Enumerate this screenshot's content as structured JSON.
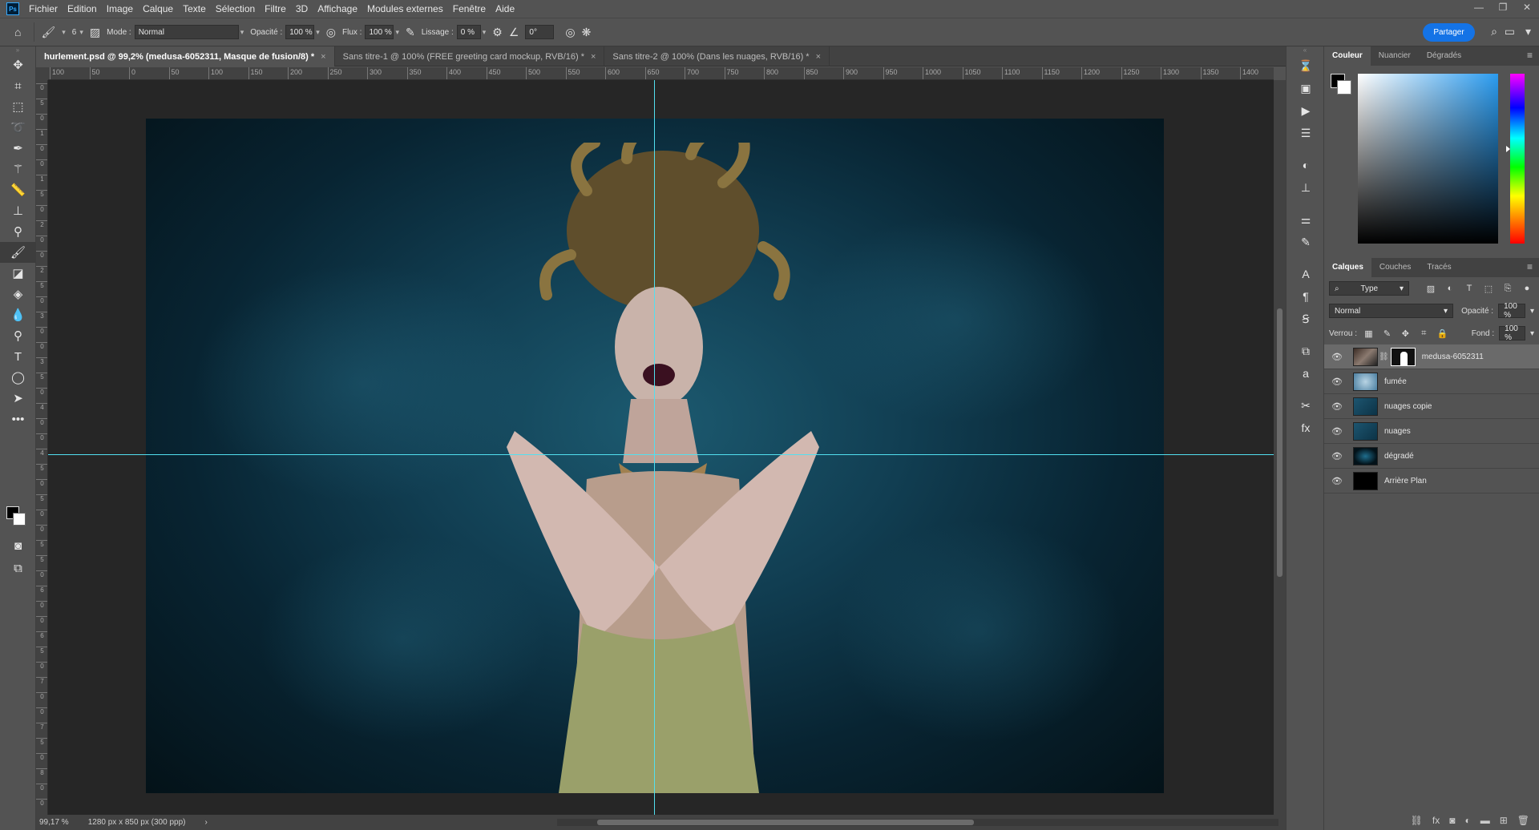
{
  "app": {
    "logo": "Ps"
  },
  "menu": [
    "Fichier",
    "Edition",
    "Image",
    "Calque",
    "Texte",
    "Sélection",
    "Filtre",
    "3D",
    "Affichage",
    "Modules externes",
    "Fenêtre",
    "Aide"
  ],
  "window_controls": [
    "—",
    "❐",
    "✕"
  ],
  "options": {
    "brush_size": "6",
    "mode_label": "Mode :",
    "mode_value": "Normal",
    "opacity_label": "Opacité :",
    "opacity_value": "100 %",
    "flow_label": "Flux :",
    "flow_value": "100 %",
    "smoothing_label": "Lissage :",
    "smoothing_value": "0 %",
    "angle_value": "0°",
    "share_label": "Partager"
  },
  "tabs": [
    {
      "label": "hurlement.psd @ 99,2% (medusa-6052311, Masque de fusion/8) *",
      "active": true
    },
    {
      "label": "Sans titre-1 @ 100% (FREE greeting card mockup, RVB/16) *",
      "active": false
    },
    {
      "label": "Sans titre-2 @ 100% (Dans les nuages, RVB/16) *",
      "active": false
    }
  ],
  "ruler_h": [
    "100",
    "50",
    "0",
    "50",
    "100",
    "150",
    "200",
    "250",
    "300",
    "350",
    "400",
    "450",
    "500",
    "550",
    "600",
    "650",
    "700",
    "750",
    "800",
    "850",
    "900",
    "950",
    "1000",
    "1050",
    "1100",
    "1150",
    "1200",
    "1250",
    "1300",
    "1350",
    "1400"
  ],
  "ruler_v": [
    "0",
    "5",
    "0",
    "1",
    "0",
    "0",
    "1",
    "5",
    "0",
    "2",
    "0",
    "0",
    "2",
    "5",
    "0",
    "3",
    "0",
    "0",
    "3",
    "5",
    "0",
    "4",
    "0",
    "0",
    "4",
    "5",
    "0",
    "5",
    "0",
    "0",
    "5",
    "5",
    "0",
    "6",
    "0",
    "0",
    "6",
    "5",
    "0",
    "7",
    "0",
    "0",
    "7",
    "5",
    "0",
    "8",
    "0",
    "0"
  ],
  "status": {
    "zoom": "99,17 %",
    "doc_size": "1280 px x 850 px (300 ppp)",
    "arrow": "›"
  },
  "color_panel": {
    "tabs": [
      "Couleur",
      "Nuancier",
      "Dégradés"
    ],
    "active": 0,
    "foreground": "#000000",
    "background": "#ffffff",
    "field_hue": "#2b9cf0"
  },
  "layers_panel": {
    "tabs": [
      "Calques",
      "Couches",
      "Tracés"
    ],
    "active": 0,
    "filter_value": "Type",
    "blend_mode": "Normal",
    "opacity_label": "Opacité :",
    "opacity_value": "100 %",
    "lock_label": "Verrou :",
    "fill_label": "Fond :",
    "fill_value": "100 %",
    "layers": [
      {
        "name": "medusa-6052311",
        "selected": true,
        "visible": true,
        "has_mask": true
      },
      {
        "name": "fumée",
        "selected": false,
        "visible": true,
        "has_mask": false
      },
      {
        "name": "nuages copie",
        "selected": false,
        "visible": true,
        "has_mask": false
      },
      {
        "name": "nuages",
        "selected": false,
        "visible": true,
        "has_mask": false
      },
      {
        "name": "dégradé",
        "selected": false,
        "visible": true,
        "has_mask": false
      },
      {
        "name": "Arrière Plan",
        "selected": false,
        "visible": true,
        "has_mask": false
      }
    ]
  },
  "colors": {
    "accent": "#1473e6",
    "guide": "#52e0f0",
    "canvas_bg": "#0c3346"
  }
}
